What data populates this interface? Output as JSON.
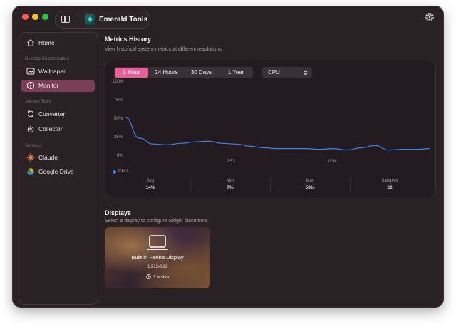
{
  "window": {
    "app_title": "Emerald Tools"
  },
  "sidebar": {
    "items": [
      {
        "label": "Home",
        "icon": "home-icon"
      },
      {
        "label": "Wallpaper",
        "icon": "image-icon"
      },
      {
        "label": "Monitor",
        "icon": "info-icon",
        "active": true
      },
      {
        "label": "Converter",
        "icon": "refresh-icon"
      },
      {
        "label": "Collector",
        "icon": "collector-icon"
      },
      {
        "label": "Claude",
        "icon": "claude-icon"
      },
      {
        "label": "Google Drive",
        "icon": "google-drive-icon"
      }
    ],
    "sections": {
      "desktop": "Desktop Customization",
      "support": "Support Tools",
      "services": "Services"
    }
  },
  "metrics": {
    "title": "Metrics History",
    "subtitle": "View historical system metrics at different resolutions.",
    "ranges": [
      "1 Hour",
      "24 Hours",
      "30 Days",
      "1 Year"
    ],
    "selected_range": "1 Hour",
    "metric_select": "CPU",
    "stats": [
      {
        "label": "Avg",
        "value": "14%"
      },
      {
        "label": "Min",
        "value": "7%"
      },
      {
        "label": "Max",
        "value": "53%"
      },
      {
        "label": "Samples",
        "value": "22"
      }
    ]
  },
  "chart_data": {
    "type": "line",
    "y_tick_labels": [
      "100%",
      "75%",
      "50%",
      "25%",
      "0%"
    ],
    "x_tick_labels": [
      "0:53",
      "0:54"
    ],
    "ylim": [
      0,
      100
    ],
    "grid": false,
    "legend_placement": "bottom-left",
    "series": [
      {
        "name": "CPU",
        "color": "#3a84f0",
        "values": [
          53,
          25,
          17,
          16,
          18,
          20,
          21,
          18,
          17,
          14,
          12,
          11,
          11,
          11,
          10,
          11,
          9,
          12,
          15,
          9,
          10,
          10,
          11
        ]
      }
    ]
  },
  "displays": {
    "title": "Displays",
    "subtitle": "Select a display to configure widget placement.",
    "cards": [
      {
        "name": "Built-in Retina Display",
        "resolution": "1,512x982",
        "active": "3 active"
      }
    ]
  },
  "colors": {
    "accent": "#e8609a",
    "sidebar_active": "#7a3e55",
    "line": "#3a84f0"
  }
}
